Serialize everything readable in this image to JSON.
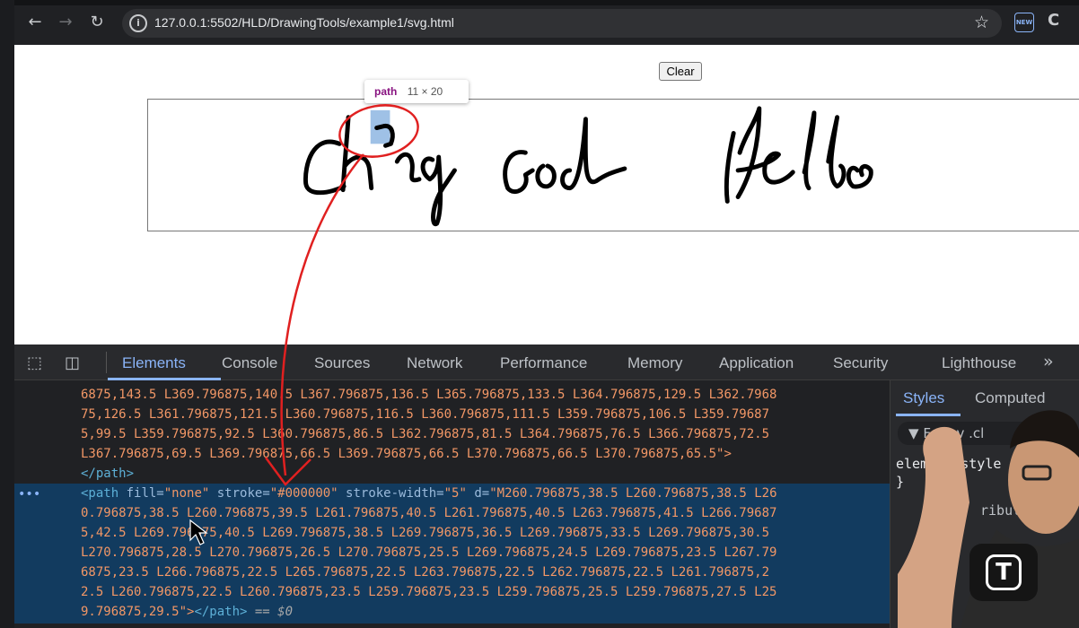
{
  "browser": {
    "url": "127.0.0.1:5502/HLD/DrawingTools/example1/svg.html",
    "ext_badge": "NEW"
  },
  "page": {
    "clear_label": "Clear",
    "tooltip_tag": "path",
    "tooltip_size": "11 × 20"
  },
  "devtools": {
    "tabs": [
      "Elements",
      "Console",
      "Sources",
      "Network",
      "Performance",
      "Memory",
      "Application",
      "Security",
      "Lighthouse"
    ],
    "active_tab": "Elements",
    "code_lines": [
      "6875,143.5 L369.796875,140.5 L367.796875,136.5 L365.796875,133.5 L364.796875,129.5 L362.7968",
      "75,126.5 L361.796875,121.5 L360.796875,116.5 L360.796875,111.5 L359.796875,106.5 L359.79687",
      "5,99.5 L359.796875,92.5 L360.796875,86.5 L362.796875,81.5 L364.796875,76.5 L366.796875,72.5",
      "L367.796875,69.5 L369.796875,66.5 L369.796875,66.5 L370.796875,66.5 L370.796875,65.5\">",
      "</path>"
    ],
    "selected": {
      "tag_open": "<path",
      "fill_attr": " fill=",
      "fill_val": "\"none\"",
      "stroke_attr": " stroke=",
      "stroke_val": "\"#000000\"",
      "width_attr": " stroke-width=",
      "width_val": "\"5\"",
      "d_attr": " d=",
      "d_start": "\"M260.796875,38.5 L260.796875,38.5 L26",
      "lines": [
        "0.796875,38.5 L260.796875,39.5 L261.796875,40.5 L261.796875,40.5 L263.796875,41.5 L266.79687",
        "5,42.5 L269.796875,40.5 L269.796875,38.5 L269.796875,36.5 L269.796875,33.5 L269.796875,30.5",
        "L270.796875,28.5 L270.796875,26.5 L270.796875,25.5 L269.796875,24.5 L269.796875,23.5 L267.79",
        "6875,23.5 L266.796875,22.5 L265.796875,22.5 L263.796875,22.5 L262.796875,22.5 L261.796875,2",
        "2.5 L260.796875,22.5 L260.796875,23.5 L259.796875,23.5 L259.796875,25.5 L259.796875,27.5 L25"
      ],
      "last_line": "9.796875,29.5\">",
      "close_tag": "</path>",
      "console_ref": " == $0"
    },
    "styles_panel": {
      "tab_styles": "Styles",
      "tab_computed": "Computed",
      "filter": "F  :hov  .cl",
      "element_style": "element.style {",
      "close_brace": "}",
      "attributes": "ributes"
    }
  },
  "colors": {
    "accent": "#8ab4f8",
    "annotation": "#e02020",
    "selection": "#123b5f"
  }
}
